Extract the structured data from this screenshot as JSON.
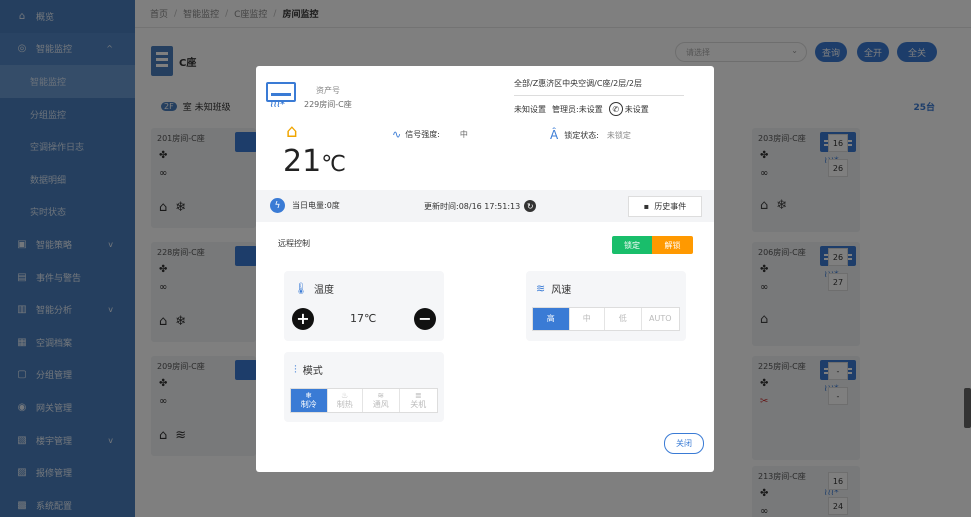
{
  "sidebar": {
    "items": [
      {
        "label": "概览",
        "icon": "home-icon"
      },
      {
        "label": "智能监控",
        "icon": "eye-icon",
        "open": true
      },
      {
        "label": "智能监控",
        "sub": true,
        "active": true
      },
      {
        "label": "分组监控",
        "sub": true
      },
      {
        "label": "空调操作日志",
        "sub": true
      },
      {
        "label": "数据明细",
        "sub": true
      },
      {
        "label": "实时状态",
        "sub": true
      },
      {
        "label": "智能策略",
        "icon": "strategy-icon"
      },
      {
        "label": "事件与警告",
        "icon": "alert-icon"
      },
      {
        "label": "智能分析",
        "icon": "analysis-icon"
      },
      {
        "label": "空调档案",
        "icon": "archive-icon"
      },
      {
        "label": "分组管理",
        "icon": "group-icon"
      },
      {
        "label": "网关管理",
        "icon": "gateway-icon"
      },
      {
        "label": "楼宇管理",
        "icon": "building-icon"
      },
      {
        "label": "报修管理",
        "icon": "repair-icon"
      },
      {
        "label": "系统配置",
        "icon": "config-icon"
      }
    ]
  },
  "breadcrumb": {
    "items": [
      "首页",
      "智能监控",
      "C座监控",
      "房间监控"
    ]
  },
  "main": {
    "building": "C座",
    "select_placeholder": "请选择",
    "buttons": {
      "query": "查询",
      "open_all": "全开",
      "close_all": "全关"
    },
    "summary_badge": "2F",
    "summary_text": "室  未知班级",
    "count": "25台",
    "left_cards": [
      "201房间-C座",
      "228房间-C座",
      "209房间-C座"
    ],
    "right_cards": [
      {
        "name": "203房间-C座",
        "t1": "16",
        "t2": "26"
      },
      {
        "name": "206房间-C座",
        "t1": "26",
        "t2": "27"
      },
      {
        "name": "225房间-C座",
        "t1": "-",
        "t2": "-"
      },
      {
        "name": "213房间-C座",
        "t1": "16",
        "t2": "24"
      }
    ]
  },
  "modal": {
    "asset_label": "资产号",
    "asset_value": "229房间-C座",
    "path": "全部/Z惠济区中央空调/C座/2层/2层",
    "unknown_setting": "未知设置",
    "manager_label": "管理员: ",
    "manager_value": "未设置",
    "phone_value": "未设置",
    "current_temp": "21",
    "temp_unit": "℃",
    "signal_label": "信号强度:",
    "signal_value": "中",
    "lock_label": "锁定状态:",
    "lock_value": "未锁定",
    "power_today": "当日电量:0度",
    "update_label": "更新时间: ",
    "update_time": "08/16 17:51:13",
    "history_button": "历史事件",
    "remote_control": "远程控制",
    "lock_button": "锁定",
    "unlock_button": "解锁",
    "temperature_title": "温度",
    "set_temp": "17℃",
    "fan_title": "风速",
    "fan_options": [
      "高",
      "中",
      "低",
      "AUTO"
    ],
    "fan_selected": 0,
    "mode_title": "模式",
    "mode_options": [
      "制冷",
      "制热",
      "通风",
      "关机"
    ],
    "mode_selected": 0,
    "close_button": "关闭"
  },
  "colors": {
    "sidebar": "#4a7fbf",
    "primary": "#3a7bd5",
    "lock_green": "#19be6b",
    "unlock_orange": "#ff9900",
    "home_orange": "#f0a500"
  }
}
